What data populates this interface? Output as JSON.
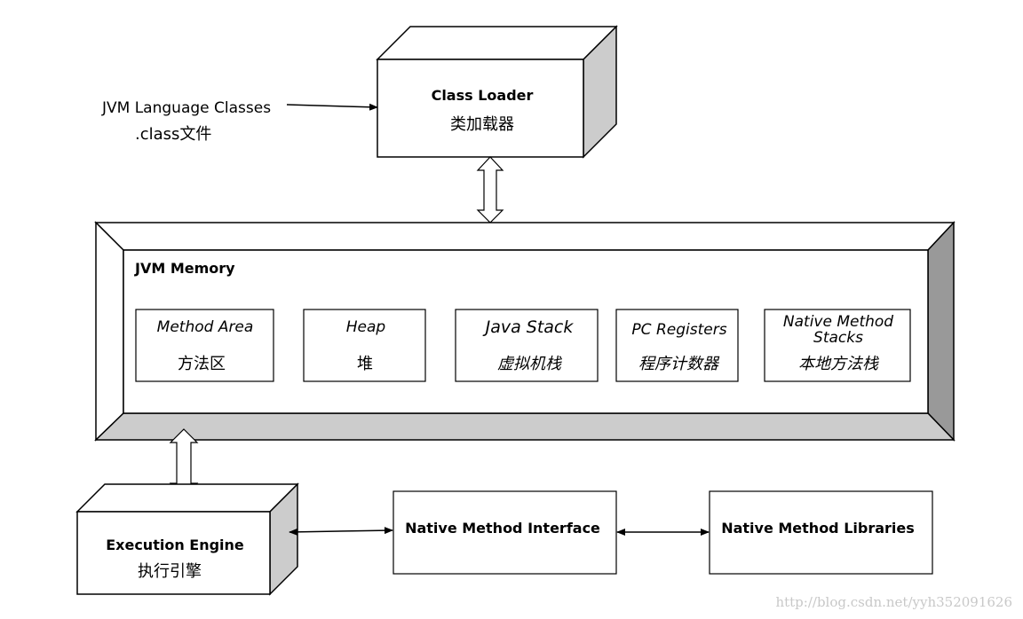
{
  "input": {
    "title": "JVM Language Classes",
    "subtitle": ".class文件"
  },
  "class_loader": {
    "title": "Class Loader",
    "subtitle": "类加载器"
  },
  "memory": {
    "title": "JVM Memory",
    "areas": [
      {
        "en": "Method Area",
        "cn": "方法区"
      },
      {
        "en": "Heap",
        "cn": "堆"
      },
      {
        "en": "Java Stack",
        "cn": "虚拟机栈"
      },
      {
        "en": "PC Registers",
        "cn": "程序计数器"
      },
      {
        "en_line1": "Native Method",
        "en_line2": "Stacks",
        "cn": "本地方法栈"
      }
    ]
  },
  "execution_engine": {
    "title": "Execution Engine",
    "subtitle": "执行引擎"
  },
  "native_interface": {
    "title": "Native Method Interface"
  },
  "native_libraries": {
    "title": "Native Method Libraries"
  },
  "watermark": "http://blog.csdn.net/yyh352091626",
  "colors": {
    "face_light": "#cccccc",
    "face_dark": "#999999",
    "stroke": "#000000",
    "watermark": "#c8c8c8"
  }
}
